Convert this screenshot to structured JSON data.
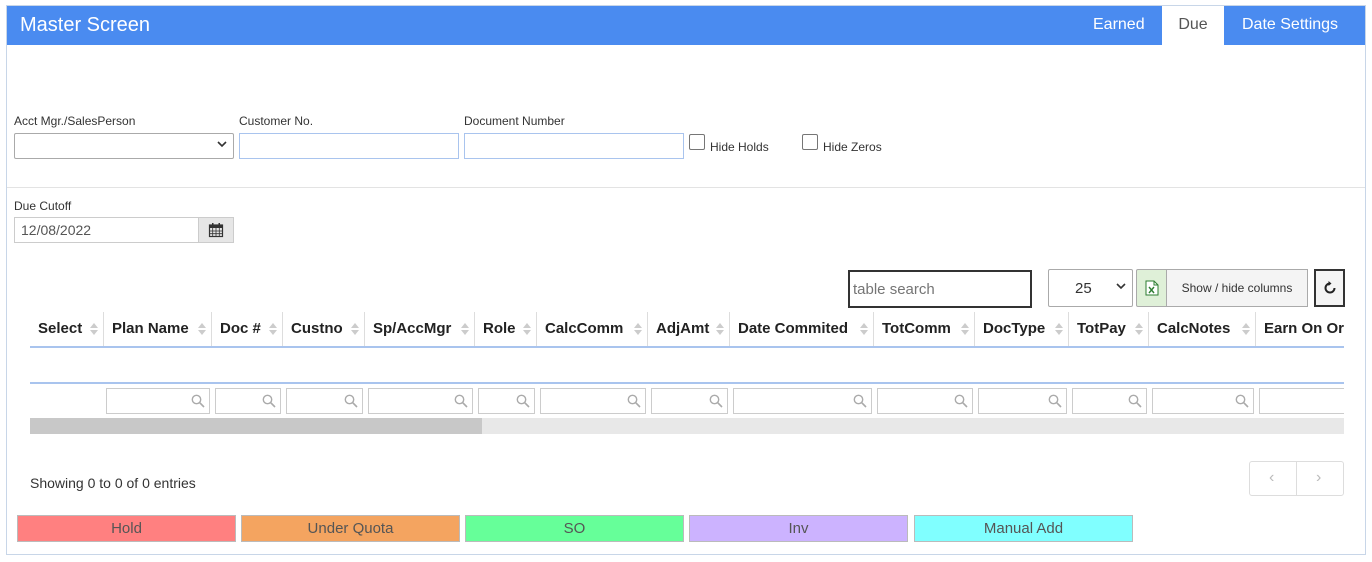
{
  "header": {
    "title": "Master Screen",
    "tabs": [
      {
        "label": "Earned"
      },
      {
        "label": "Due"
      },
      {
        "label": "Date Settings"
      }
    ],
    "active_tab": "Due",
    "color": "#4a8bf0"
  },
  "filters": {
    "acct_mgr_label": "Acct Mgr./SalesPerson",
    "acct_mgr_value": "",
    "customer_label": "Customer No.",
    "customer_value": "",
    "document_label": "Document Number",
    "document_value": "",
    "hide_holds_label": "Hide Holds",
    "hide_zeros_label": "Hide Zeros"
  },
  "due_cutoff": {
    "label": "Due Cutoff",
    "value": "12/08/2022"
  },
  "table_controls": {
    "search_placeholder": "table search",
    "page_size": "25",
    "show_hide_label": "Show / hide columns"
  },
  "table": {
    "columns": [
      "Select",
      "Plan Name",
      "Doc #",
      "Custno",
      "Sp/AccMgr",
      "Role",
      "CalcComm",
      "AdjAmt",
      "Date Commited",
      "TotComm",
      "DocType",
      "TotPay",
      "CalcNotes",
      "Earn On Or"
    ],
    "rows": []
  },
  "footer": {
    "showing_text": "Showing 0 to 0 of 0 entries",
    "prev": "‹",
    "next": "›"
  },
  "legend": [
    {
      "label": "Hold",
      "color": "#ff8080"
    },
    {
      "label": "Under Quota",
      "color": "#f4a460"
    },
    {
      "label": "SO",
      "color": "#66ff99"
    },
    {
      "label": "Inv",
      "color": "#ccb3ff"
    },
    {
      "label": "Manual Add",
      "color": "#80ffff"
    }
  ]
}
